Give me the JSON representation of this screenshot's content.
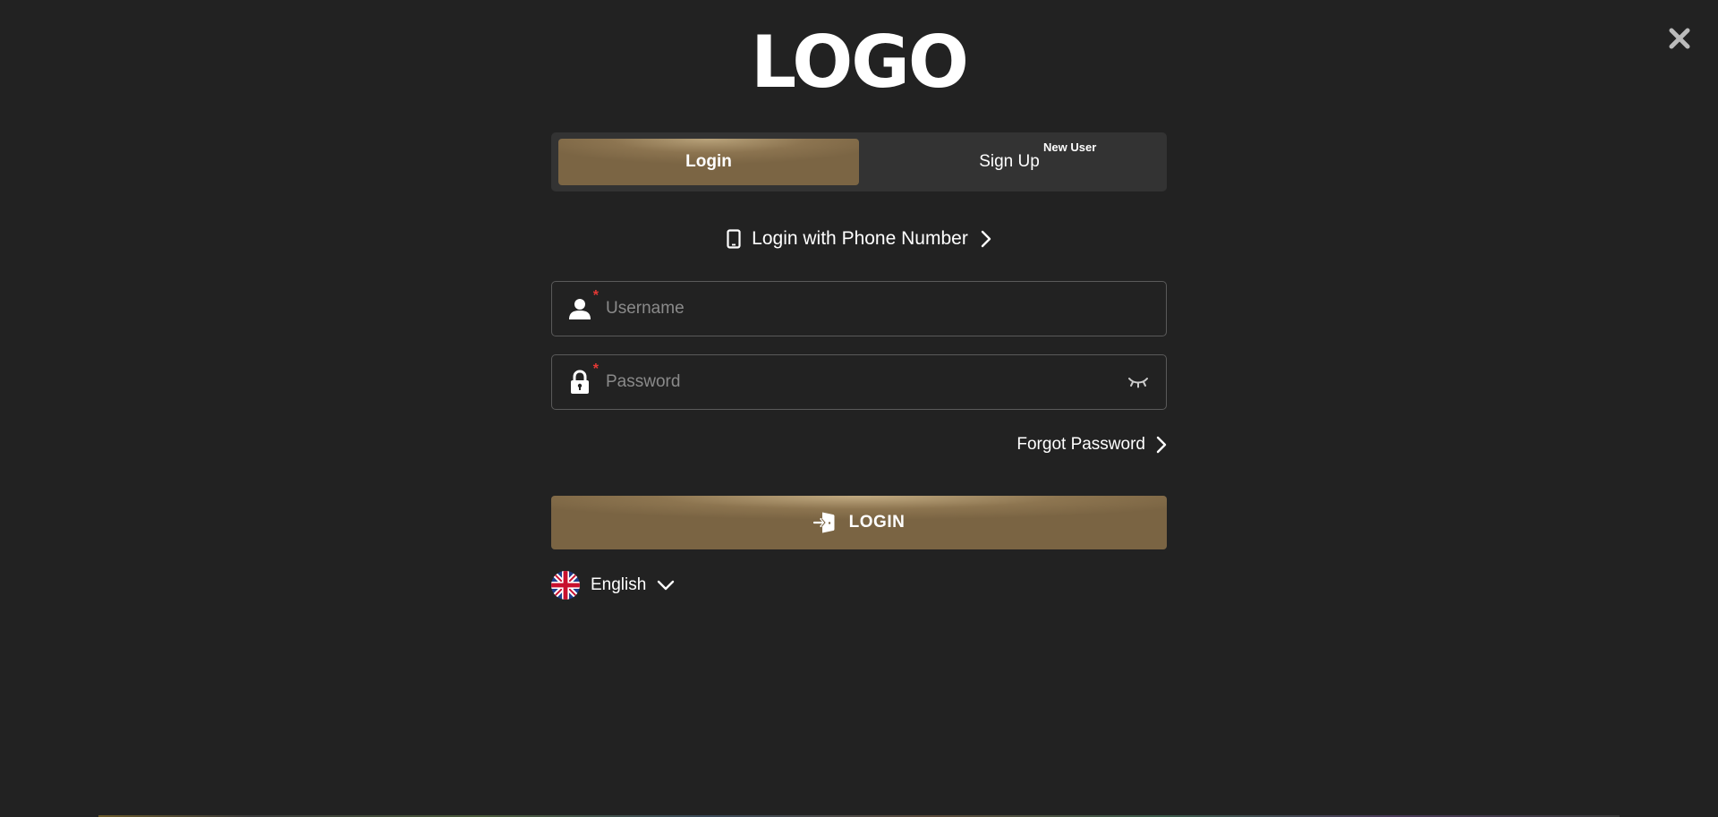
{
  "logo": {
    "text": "LOGO"
  },
  "tabs": [
    {
      "label": "Login",
      "active": true
    },
    {
      "label": "Sign Up",
      "badge": "New User",
      "active": false
    }
  ],
  "phone_login": {
    "label": "Login with Phone Number",
    "icon": "mobile-phone-icon"
  },
  "fields": {
    "username": {
      "placeholder": "Username",
      "value": "",
      "icon": "user-icon",
      "required": "*"
    },
    "password": {
      "placeholder": "Password",
      "value": "",
      "icon": "lock-icon",
      "required": "*",
      "toggle_icon": "eye-closed-icon"
    }
  },
  "forgot_password": {
    "label": "Forgot Password"
  },
  "login_button": {
    "label": "LOGIN",
    "icon": "login-door-icon"
  },
  "language": {
    "selected": "English",
    "icon": "uk-flag-icon"
  },
  "colors": {
    "background": "#222222",
    "accent_gold": "#8c7450",
    "tab_bar": "#333333",
    "required_marker": "#e53935",
    "placeholder": "#8a8a8a"
  }
}
